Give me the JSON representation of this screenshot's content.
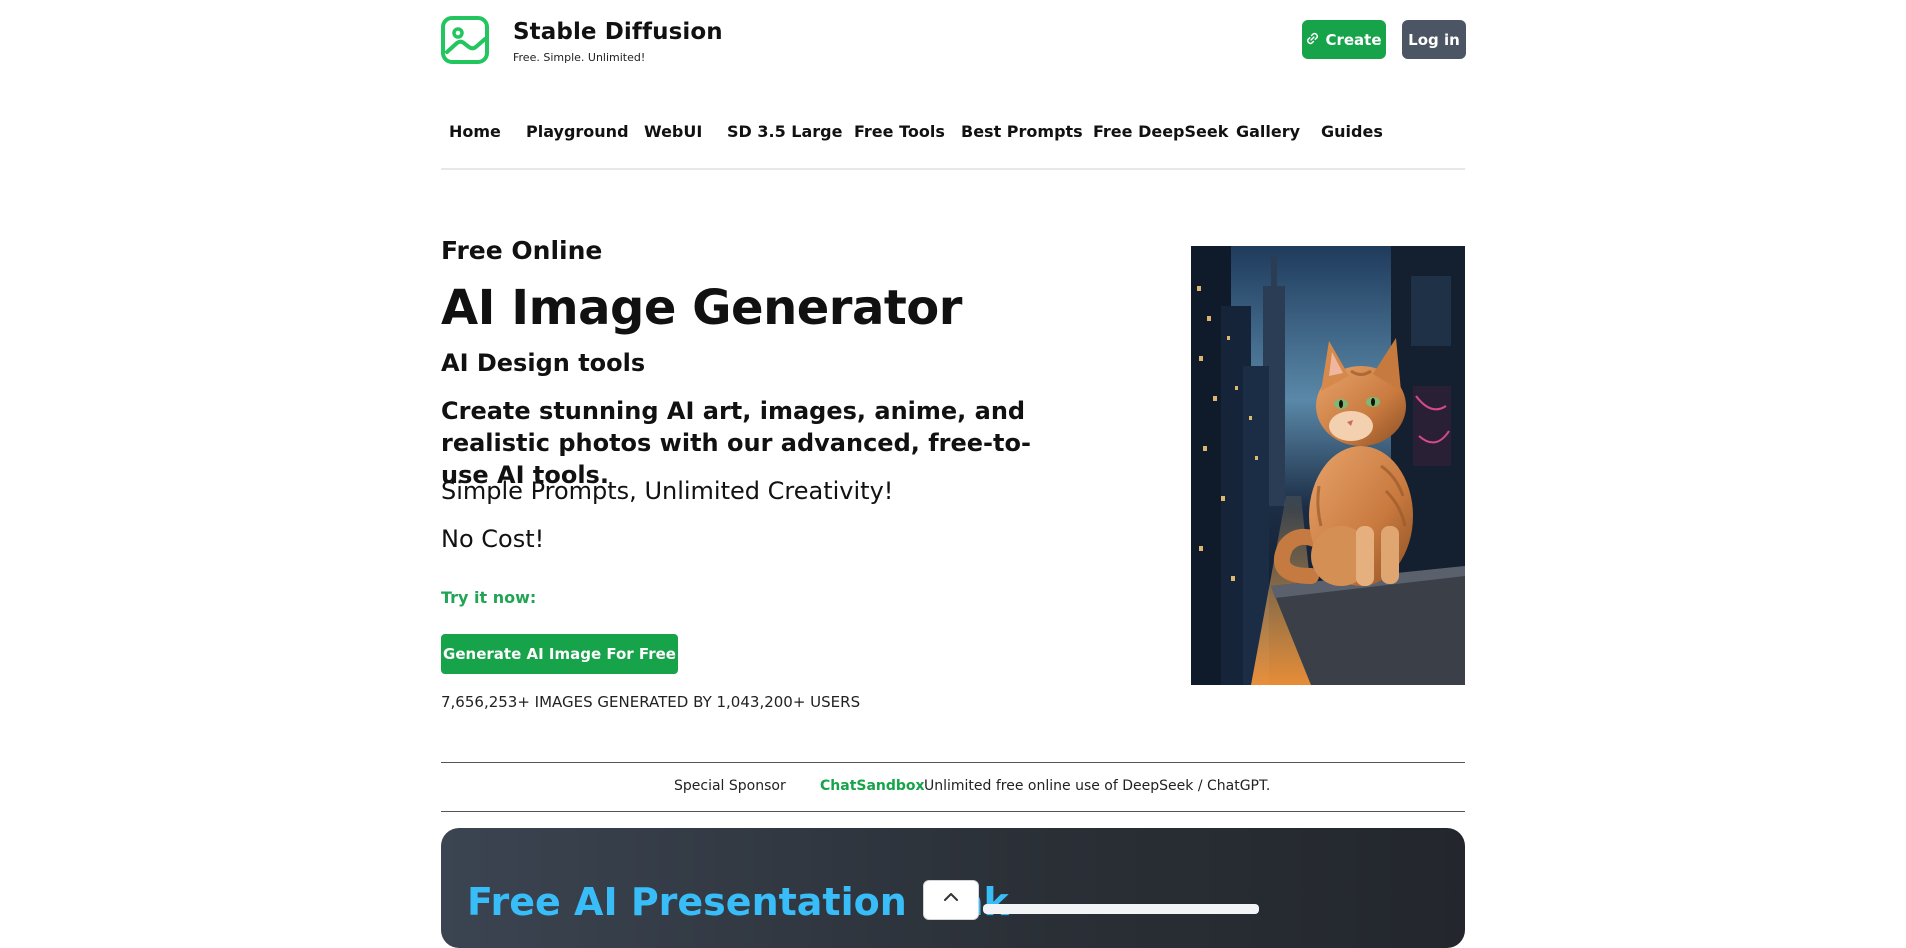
{
  "brand": {
    "title": "Stable Diffusion",
    "tagline": "Free. Simple. Unlimited!",
    "logo_icon": "image-logo-icon",
    "accent": "#22c55e"
  },
  "header": {
    "create_label": "Create",
    "create_icon": "link-icon",
    "login_label": "Log in"
  },
  "nav": {
    "items": [
      "Home",
      "Playground",
      "WebUI",
      "SD 3.5 Large",
      "Free Tools",
      "Best Prompts",
      "Free DeepSeek",
      "Gallery",
      "Guides"
    ]
  },
  "hero": {
    "kicker": "Free Online",
    "title": "AI Image Generator",
    "subtitle": "AI Design tools",
    "description": "Create stunning AI art, images, anime, and realistic photos with our advanced, free-to-use AI tools.",
    "line1": "Simple Prompts, Unlimited Creativity!",
    "line2": "No Cost!",
    "try_label": "Try it now:",
    "cta_label": "Generate AI Image For Free",
    "stats": "7,656,253+ IMAGES GENERATED BY 1,043,200+ USERS"
  },
  "sponsor": {
    "label": "Special Sponsor",
    "name": "ChatSandbox",
    "text": "Unlimited free online use of DeepSeek / ChatGPT."
  },
  "promo": {
    "title": "Free AI Presentation Mak"
  },
  "colors": {
    "primary_green": "#16a34a",
    "login_gray": "#4b5563",
    "promo_title": "#38bdf8"
  }
}
